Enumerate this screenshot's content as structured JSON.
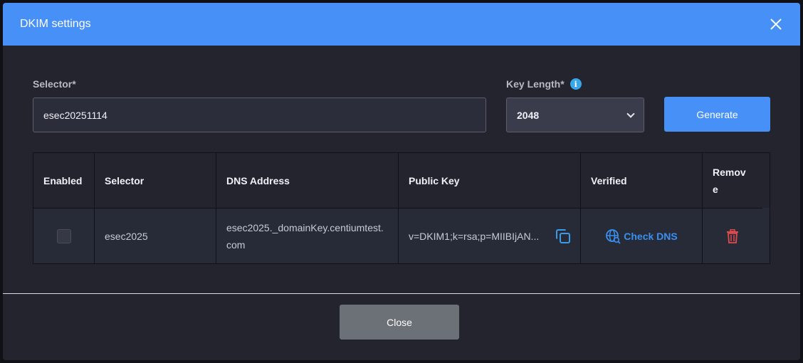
{
  "modal": {
    "title": "DKIM settings"
  },
  "form": {
    "selector_label": "Selector*",
    "selector_value": "esec20251114",
    "key_length_label": "Key Length*",
    "info_icon": "info-icon",
    "key_length_value": "2048",
    "generate_label": "Generate"
  },
  "table": {
    "headers": [
      "Enabled",
      "Selector",
      "DNS Address",
      "Public Key",
      "Verified",
      "Remov",
      "e"
    ],
    "rows": [
      {
        "enabled": false,
        "selector": "esec2025",
        "dns_address": "esec2025._domainKey.centiumtest.com",
        "public_key": "v=DKIM1;k=rsa;p=MIIBIjAN...",
        "verified_action": "Check DNS"
      }
    ]
  },
  "footer": {
    "close_label": "Close"
  },
  "colors": {
    "accent": "#4690f7",
    "link": "#3a8ff0",
    "danger": "#e14b4b"
  }
}
